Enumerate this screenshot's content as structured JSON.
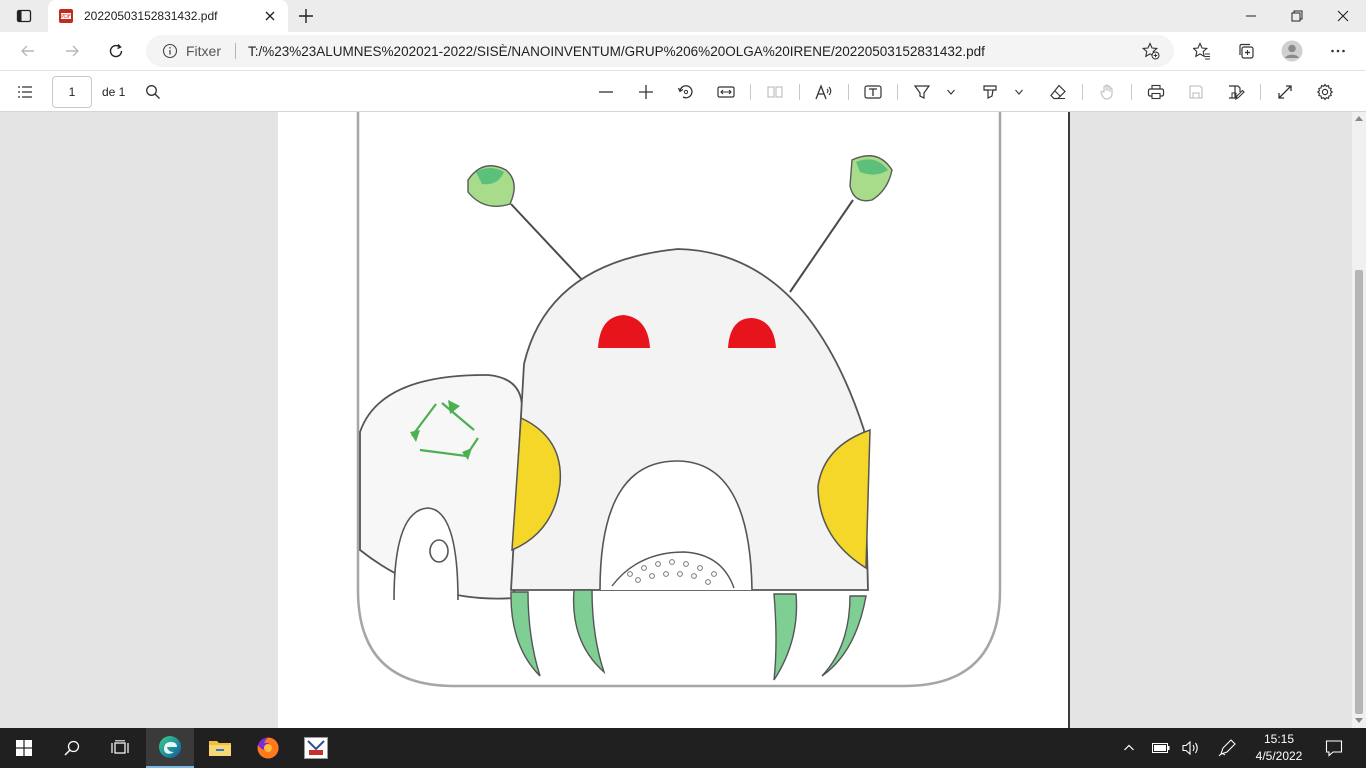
{
  "tab": {
    "title": "20220503152831432.pdf"
  },
  "address": {
    "scheme_label": "Fitxer",
    "url": "T:/%23%23ALUMNES%202021-2022/SISÈ/NANOINVENTUM/GRUP%206%20OLGA%20IRENE/20220503152831432.pdf"
  },
  "pdf_toolbar": {
    "page_number": "1",
    "page_count": "de 1"
  },
  "taskbar": {
    "time": "15:15",
    "date": "4/5/2022"
  },
  "colors": {
    "accent": "#0078d4",
    "pdf_red": "#c42b1c",
    "drawing_red": "#e8141c",
    "drawing_yellow": "#f5d72a",
    "drawing_green": "#5cc07a"
  },
  "icons": [
    "tab-actions-icon",
    "pdf-file-icon",
    "close-icon",
    "plus-icon",
    "minimize-icon",
    "restore-icon",
    "back-icon",
    "forward-icon",
    "refresh-icon",
    "info-icon",
    "favorite-add-icon",
    "favorites-icon",
    "collections-icon",
    "profile-icon",
    "more-icon",
    "contents-icon",
    "search-icon",
    "zoom-out-icon",
    "zoom-in-icon",
    "rotate-icon",
    "fit-width-icon",
    "page-view-icon",
    "read-aloud-icon",
    "text-icon",
    "highlight-icon",
    "draw-icon",
    "eraser-icon",
    "hand-icon",
    "print-icon",
    "save-icon",
    "save-as-icon",
    "fullscreen-icon",
    "settings-icon",
    "windows-start-icon",
    "taskbar-search-icon",
    "task-view-icon",
    "edge-icon",
    "file-explorer-icon",
    "firefox-icon",
    "app-icon",
    "chevron-up-icon",
    "battery-icon",
    "volume-icon",
    "pen-icon",
    "notification-icon"
  ]
}
